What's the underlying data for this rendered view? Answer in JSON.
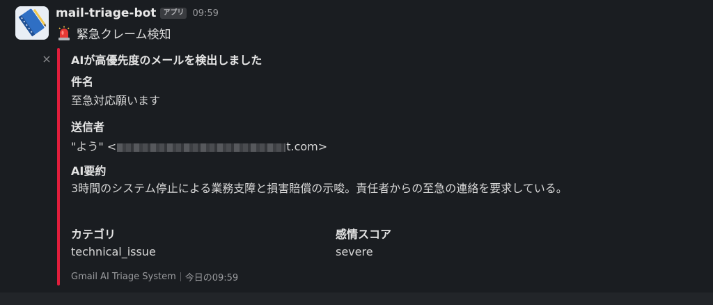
{
  "message": {
    "bot_name": "mail-triage-bot",
    "app_badge": "アプリ",
    "timestamp": "09:59",
    "alert_icon": "siren-icon",
    "alert_text": "緊急クレーム検知"
  },
  "attachment": {
    "accent_color": "#e01e3c",
    "title": "AIが高優先度のメールを検出しました",
    "subject_label": "件名",
    "subject_value": "至急対応願います",
    "sender_label": "送信者",
    "sender_prefix": "\"よう\" <",
    "sender_suffix": "t.com>",
    "summary_label": "AI要約",
    "summary_value": "3時間のシステム停止による業務支障と損害賠償の示唆。責任者からの至急の連絡を要求している。",
    "category_label": "カテゴリ",
    "category_value": "technical_issue",
    "sentiment_label": "感情スコア",
    "sentiment_value": "severe",
    "footer_source": "Gmail AI Triage System",
    "footer_time": "今日の09:59"
  }
}
